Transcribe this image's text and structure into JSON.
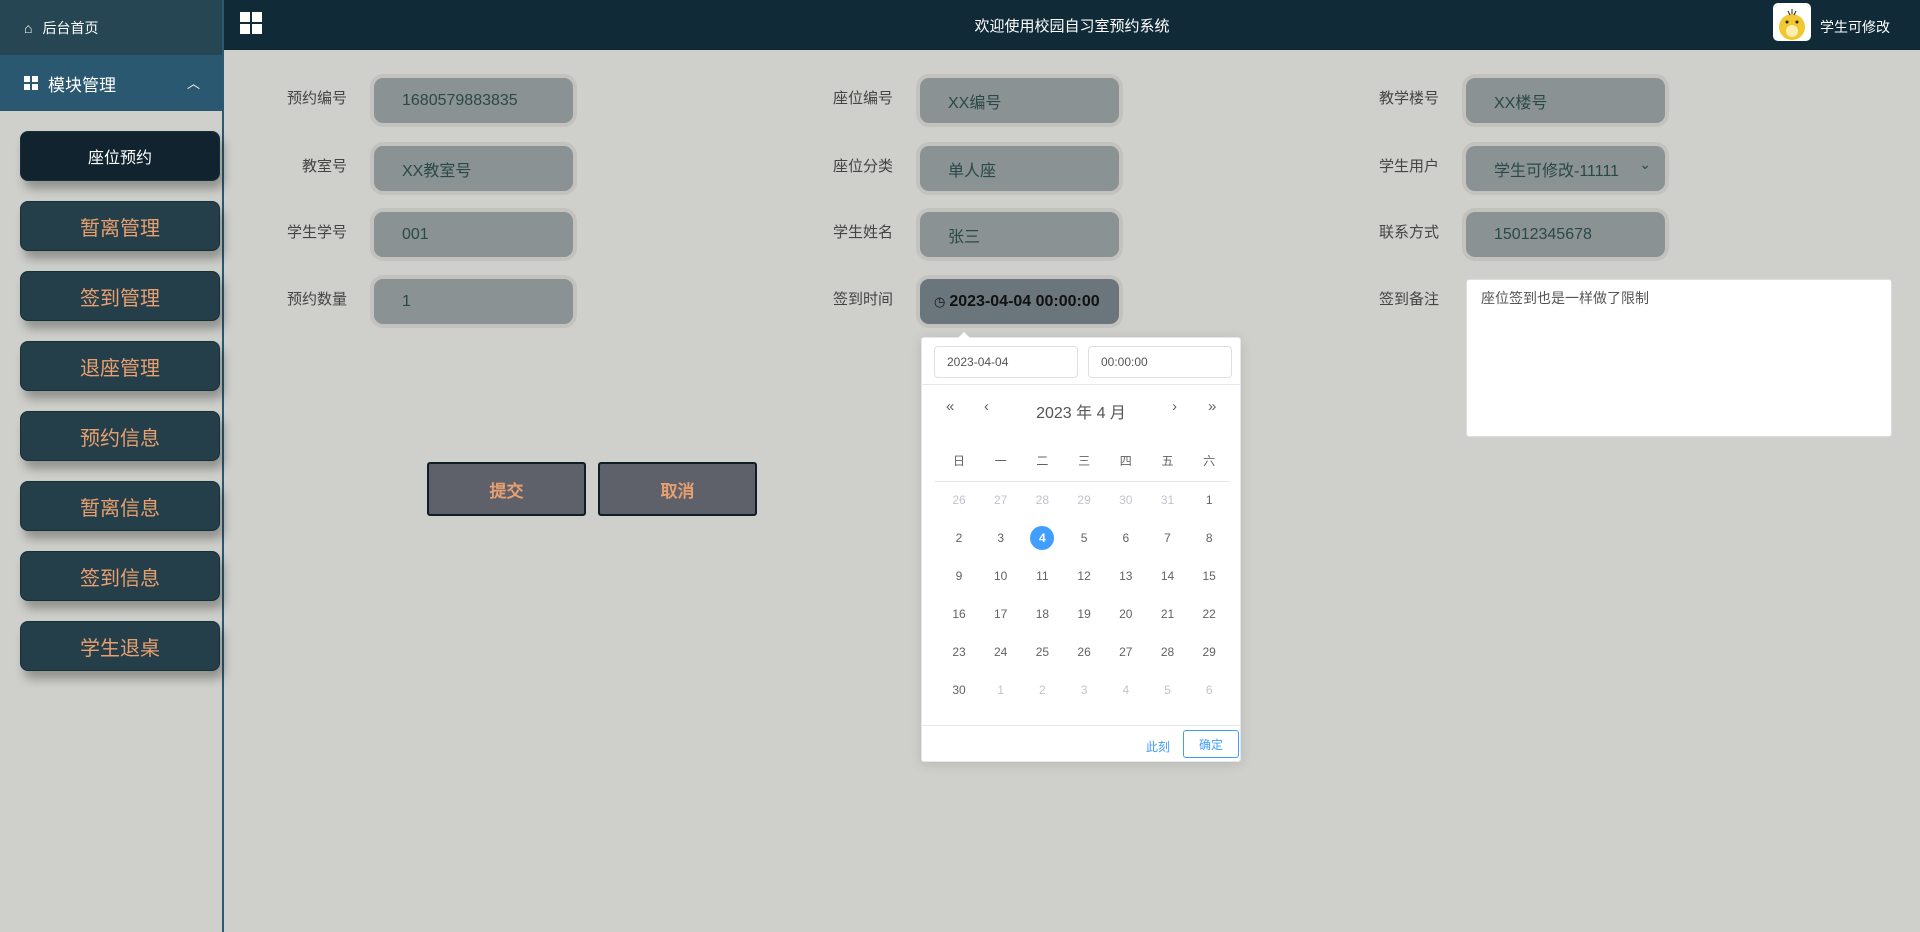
{
  "sidebar": {
    "home": "后台首页",
    "module": "模块管理",
    "items": [
      "座位预约",
      "暂离管理",
      "签到管理",
      "退座管理",
      "预约信息",
      "暂离信息",
      "签到信息",
      "学生退桌"
    ]
  },
  "header": {
    "title": "欢迎使用校园自习室预约系统",
    "user": "学生可修改"
  },
  "form": {
    "fields": [
      {
        "label": "预约编号",
        "value": "1680579883835"
      },
      {
        "label": "座位编号",
        "value": "XX编号"
      },
      {
        "label": "教学楼号",
        "value": "XX楼号"
      },
      {
        "label": "教室号",
        "value": "XX教室号"
      },
      {
        "label": "座位分类",
        "value": "单人座"
      },
      {
        "label": "学生用户",
        "value": "学生可修改-11111"
      },
      {
        "label": "学生学号",
        "value": "001"
      },
      {
        "label": "学生姓名",
        "value": "张三"
      },
      {
        "label": "联系方式",
        "value": "15012345678"
      },
      {
        "label": "预约数量",
        "value": "1"
      },
      {
        "label": "签到时间",
        "value": "2023-04-04 00:00:00"
      },
      {
        "label": "签到备注",
        "value": "座位签到也是一样做了限制"
      }
    ],
    "submit": "提交",
    "cancel": "取消"
  },
  "picker": {
    "date": "2023-04-04",
    "time": "00:00:00",
    "year_month": "2023 年  4 月",
    "nav": {
      "prev_year": "«",
      "prev_month": "‹",
      "next_month": "›",
      "next_year": "»"
    },
    "weekdays": [
      "日",
      "一",
      "二",
      "三",
      "四",
      "五",
      "六"
    ],
    "days": [
      [
        "26",
        "27",
        "28",
        "29",
        "30",
        "31",
        "1"
      ],
      [
        "2",
        "3",
        "4",
        "5",
        "6",
        "7",
        "8"
      ],
      [
        "9",
        "10",
        "11",
        "12",
        "13",
        "14",
        "15"
      ],
      [
        "16",
        "17",
        "18",
        "19",
        "20",
        "21",
        "22"
      ],
      [
        "23",
        "24",
        "25",
        "26",
        "27",
        "28",
        "29"
      ],
      [
        "30",
        "1",
        "2",
        "3",
        "4",
        "5",
        "6"
      ]
    ],
    "selected": "4",
    "now": "此刻",
    "confirm": "确定"
  },
  "colors": {
    "header": "#112a38",
    "menu": "#243f4a",
    "accent": "#e8a070",
    "selected": "#409eff"
  }
}
